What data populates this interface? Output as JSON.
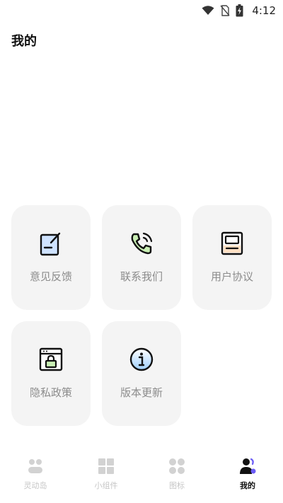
{
  "status_bar": {
    "time": "4:12",
    "icons": [
      "wifi-icon",
      "no-sim-icon",
      "battery-charging-icon"
    ]
  },
  "page": {
    "title": "我的"
  },
  "cards": [
    {
      "label": "意见反馈",
      "icon": "feedback-icon"
    },
    {
      "label": "联系我们",
      "icon": "phone-icon"
    },
    {
      "label": "用户协议",
      "icon": "agreement-icon"
    },
    {
      "label": "隐私政策",
      "icon": "privacy-lock-icon"
    },
    {
      "label": "版本更新",
      "icon": "info-icon"
    }
  ],
  "tabbar": {
    "active_color": "#111111",
    "inactive_color": "#c6c6c6",
    "accent_color": "#6b5cf6",
    "tabs": [
      {
        "label": "灵动岛",
        "icon": "island-icon",
        "active": false
      },
      {
        "label": "小组件",
        "icon": "widgets-grid-icon",
        "active": false
      },
      {
        "label": "图标",
        "icon": "icons-dots-icon",
        "active": false
      },
      {
        "label": "我的",
        "icon": "profile-icon",
        "active": true
      }
    ]
  }
}
